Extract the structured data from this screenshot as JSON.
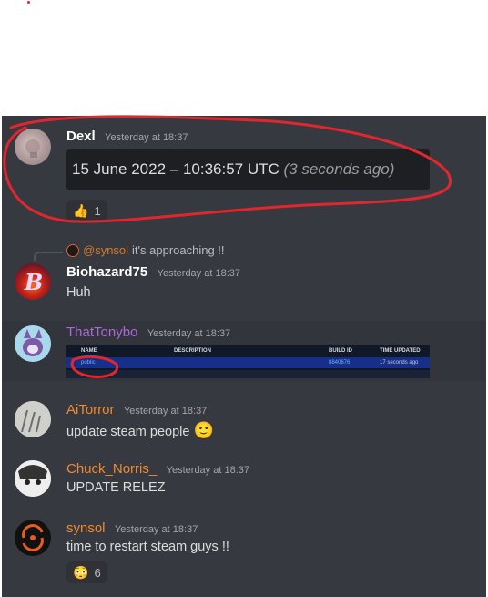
{
  "messages": {
    "dexl": {
      "username": "Dexl",
      "timestamp": "Yesterday at 18:37",
      "name_color": "#ffffff",
      "embed_date": "15 June 2022 – 10:36:57 UTC",
      "embed_relative": "(3 seconds ago)",
      "reaction_emoji": "👍",
      "reaction_count": "1"
    },
    "biohazard": {
      "reply_mention": "@synsol",
      "reply_text": "it's approaching !!",
      "username": "Biohazard75",
      "timestamp": "Yesterday at 18:37",
      "name_color": "#ffffff",
      "text": "Huh"
    },
    "thattonybo": {
      "username": "ThatTonybo",
      "timestamp": "Yesterday at 18:37",
      "name_color": "#a96ad8",
      "table": {
        "headers": [
          "NAME",
          "DESCRIPTION",
          "BUILD ID",
          "TIME UPDATED"
        ],
        "row": {
          "name": "public",
          "description": "",
          "build_id": "8840676",
          "time_updated": "17 seconds ago"
        }
      }
    },
    "aitorror": {
      "username": "AiTorror",
      "timestamp": "Yesterday at 18:37",
      "name_color": "#f08a2e",
      "text": "update steam people",
      "emoji": "🙂"
    },
    "chuck": {
      "username": "Chuck_Norris_",
      "timestamp": "Yesterday at 18:37",
      "name_color": "#f08a2e",
      "text": "UPDATE RELEZ"
    },
    "synsol": {
      "username": "synsol",
      "timestamp": "Yesterday at 18:37",
      "name_color": "#f08a2e",
      "text": "time to restart steam guys !!",
      "reaction_emoji": "😳",
      "reaction_count": "6"
    }
  },
  "colors": {
    "background": "#36393f",
    "annotation_ink": "#e0262e",
    "mention": "#d67a2b"
  }
}
